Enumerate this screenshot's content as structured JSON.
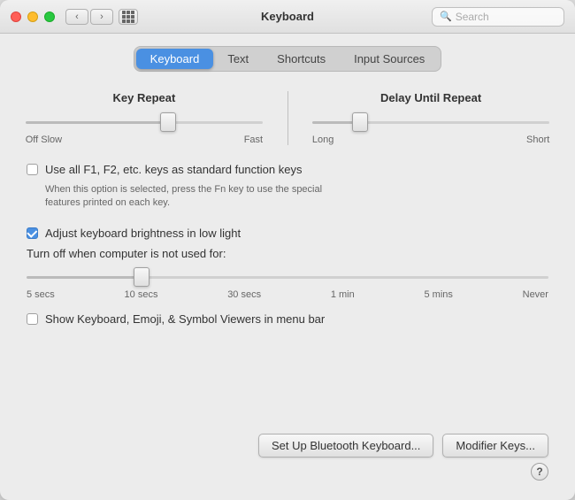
{
  "window": {
    "title": "Keyboard"
  },
  "titlebar": {
    "traffic_lights": [
      "close",
      "minimize",
      "maximize"
    ],
    "search_placeholder": "Search"
  },
  "tabs": [
    {
      "id": "keyboard",
      "label": "Keyboard",
      "active": true
    },
    {
      "id": "text",
      "label": "Text",
      "active": false
    },
    {
      "id": "shortcuts",
      "label": "Shortcuts",
      "active": false
    },
    {
      "id": "input-sources",
      "label": "Input Sources",
      "active": false
    }
  ],
  "key_repeat": {
    "label": "Key Repeat",
    "left_label": "Off Slow",
    "right_label": "Fast"
  },
  "delay_until_repeat": {
    "label": "Delay Until Repeat",
    "left_label": "Long",
    "right_label": "Short"
  },
  "fn_keys": {
    "label": "Use all F1, F2, etc. keys as standard function keys",
    "subtext": "When this option is selected, press the Fn key to use the special\nfeatures printed on each key.",
    "checked": false
  },
  "brightness": {
    "label": "Adjust keyboard brightness in low light",
    "checked": true,
    "turn_off_label": "Turn off when computer is not used for:",
    "tick_labels": [
      "5 secs",
      "10 secs",
      "30 secs",
      "1 min",
      "5 mins",
      "Never"
    ]
  },
  "show_keyboard": {
    "label": "Show Keyboard, Emoji, & Symbol Viewers in menu bar",
    "checked": false
  },
  "buttons": {
    "bluetooth": "Set Up Bluetooth Keyboard...",
    "modifier": "Modifier Keys..."
  },
  "help": "?"
}
